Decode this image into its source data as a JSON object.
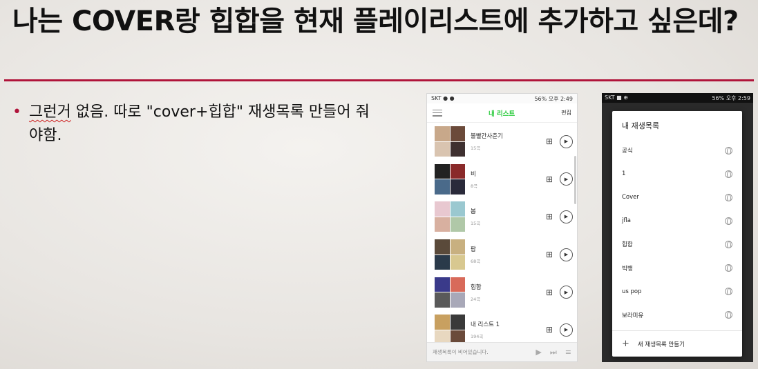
{
  "slide": {
    "title": "나는 COVER랑 힙합을 현재 플레이리스트에 추가하고 싶은데?",
    "bullet": "그런거 없음. 따로 \"cover+힙합\" 재생목록 만들어 줘야함.",
    "bullet_underlined": "그런거",
    "bullet_rest": " 없음. 따로 \"cover+힙합\" 재생목록 만들어 줘야함."
  },
  "phone1": {
    "status_left": "SKT ● ●",
    "status_right": "56% 오후 2:49",
    "header_title": "내 리스트",
    "edit_label": "편집",
    "playlists": [
      {
        "name": "볼빨간사춘기",
        "count": "15곡",
        "colors": [
          "#c8a88a",
          "#6b4a3a",
          "#d9c4b0",
          "#3e3030"
        ]
      },
      {
        "name": "비",
        "count": "8곡",
        "colors": [
          "#222",
          "#8a2a2a",
          "#4a6a8a",
          "#2a2a3a"
        ]
      },
      {
        "name": "봄",
        "count": "15곡",
        "colors": [
          "#e8c8d0",
          "#9ac8d0",
          "#d8b0a0",
          "#b0c8a8"
        ]
      },
      {
        "name": "팝",
        "count": "68곡",
        "colors": [
          "#5a4a3a",
          "#c8b080",
          "#2a3a4a",
          "#d8c890"
        ]
      },
      {
        "name": "힙합",
        "count": "24곡",
        "colors": [
          "#3a3a8a",
          "#d86a5a",
          "#5a5a5a",
          "#a8a8b8"
        ]
      },
      {
        "name": "내 리스트 1",
        "count": "194곡",
        "colors": [
          "#c8a060",
          "#3a3a3a",
          "#e8d8c0",
          "#6a4a3a"
        ]
      }
    ],
    "player_text": "재생목록이 비어있습니다."
  },
  "phone2": {
    "status_left": "SKT ■ ⊕",
    "status_right": "56% 오후 2:59",
    "dialog_title": "내 재생목록",
    "playlists": [
      "공식",
      "1",
      "Cover",
      "jfla",
      "힙합",
      "빅뱅",
      "us pop",
      "보라미유"
    ],
    "new_playlist_label": "새 재생목록 만들기"
  },
  "colors": {
    "accent": "#b0143a",
    "green": "#2ecc40"
  }
}
